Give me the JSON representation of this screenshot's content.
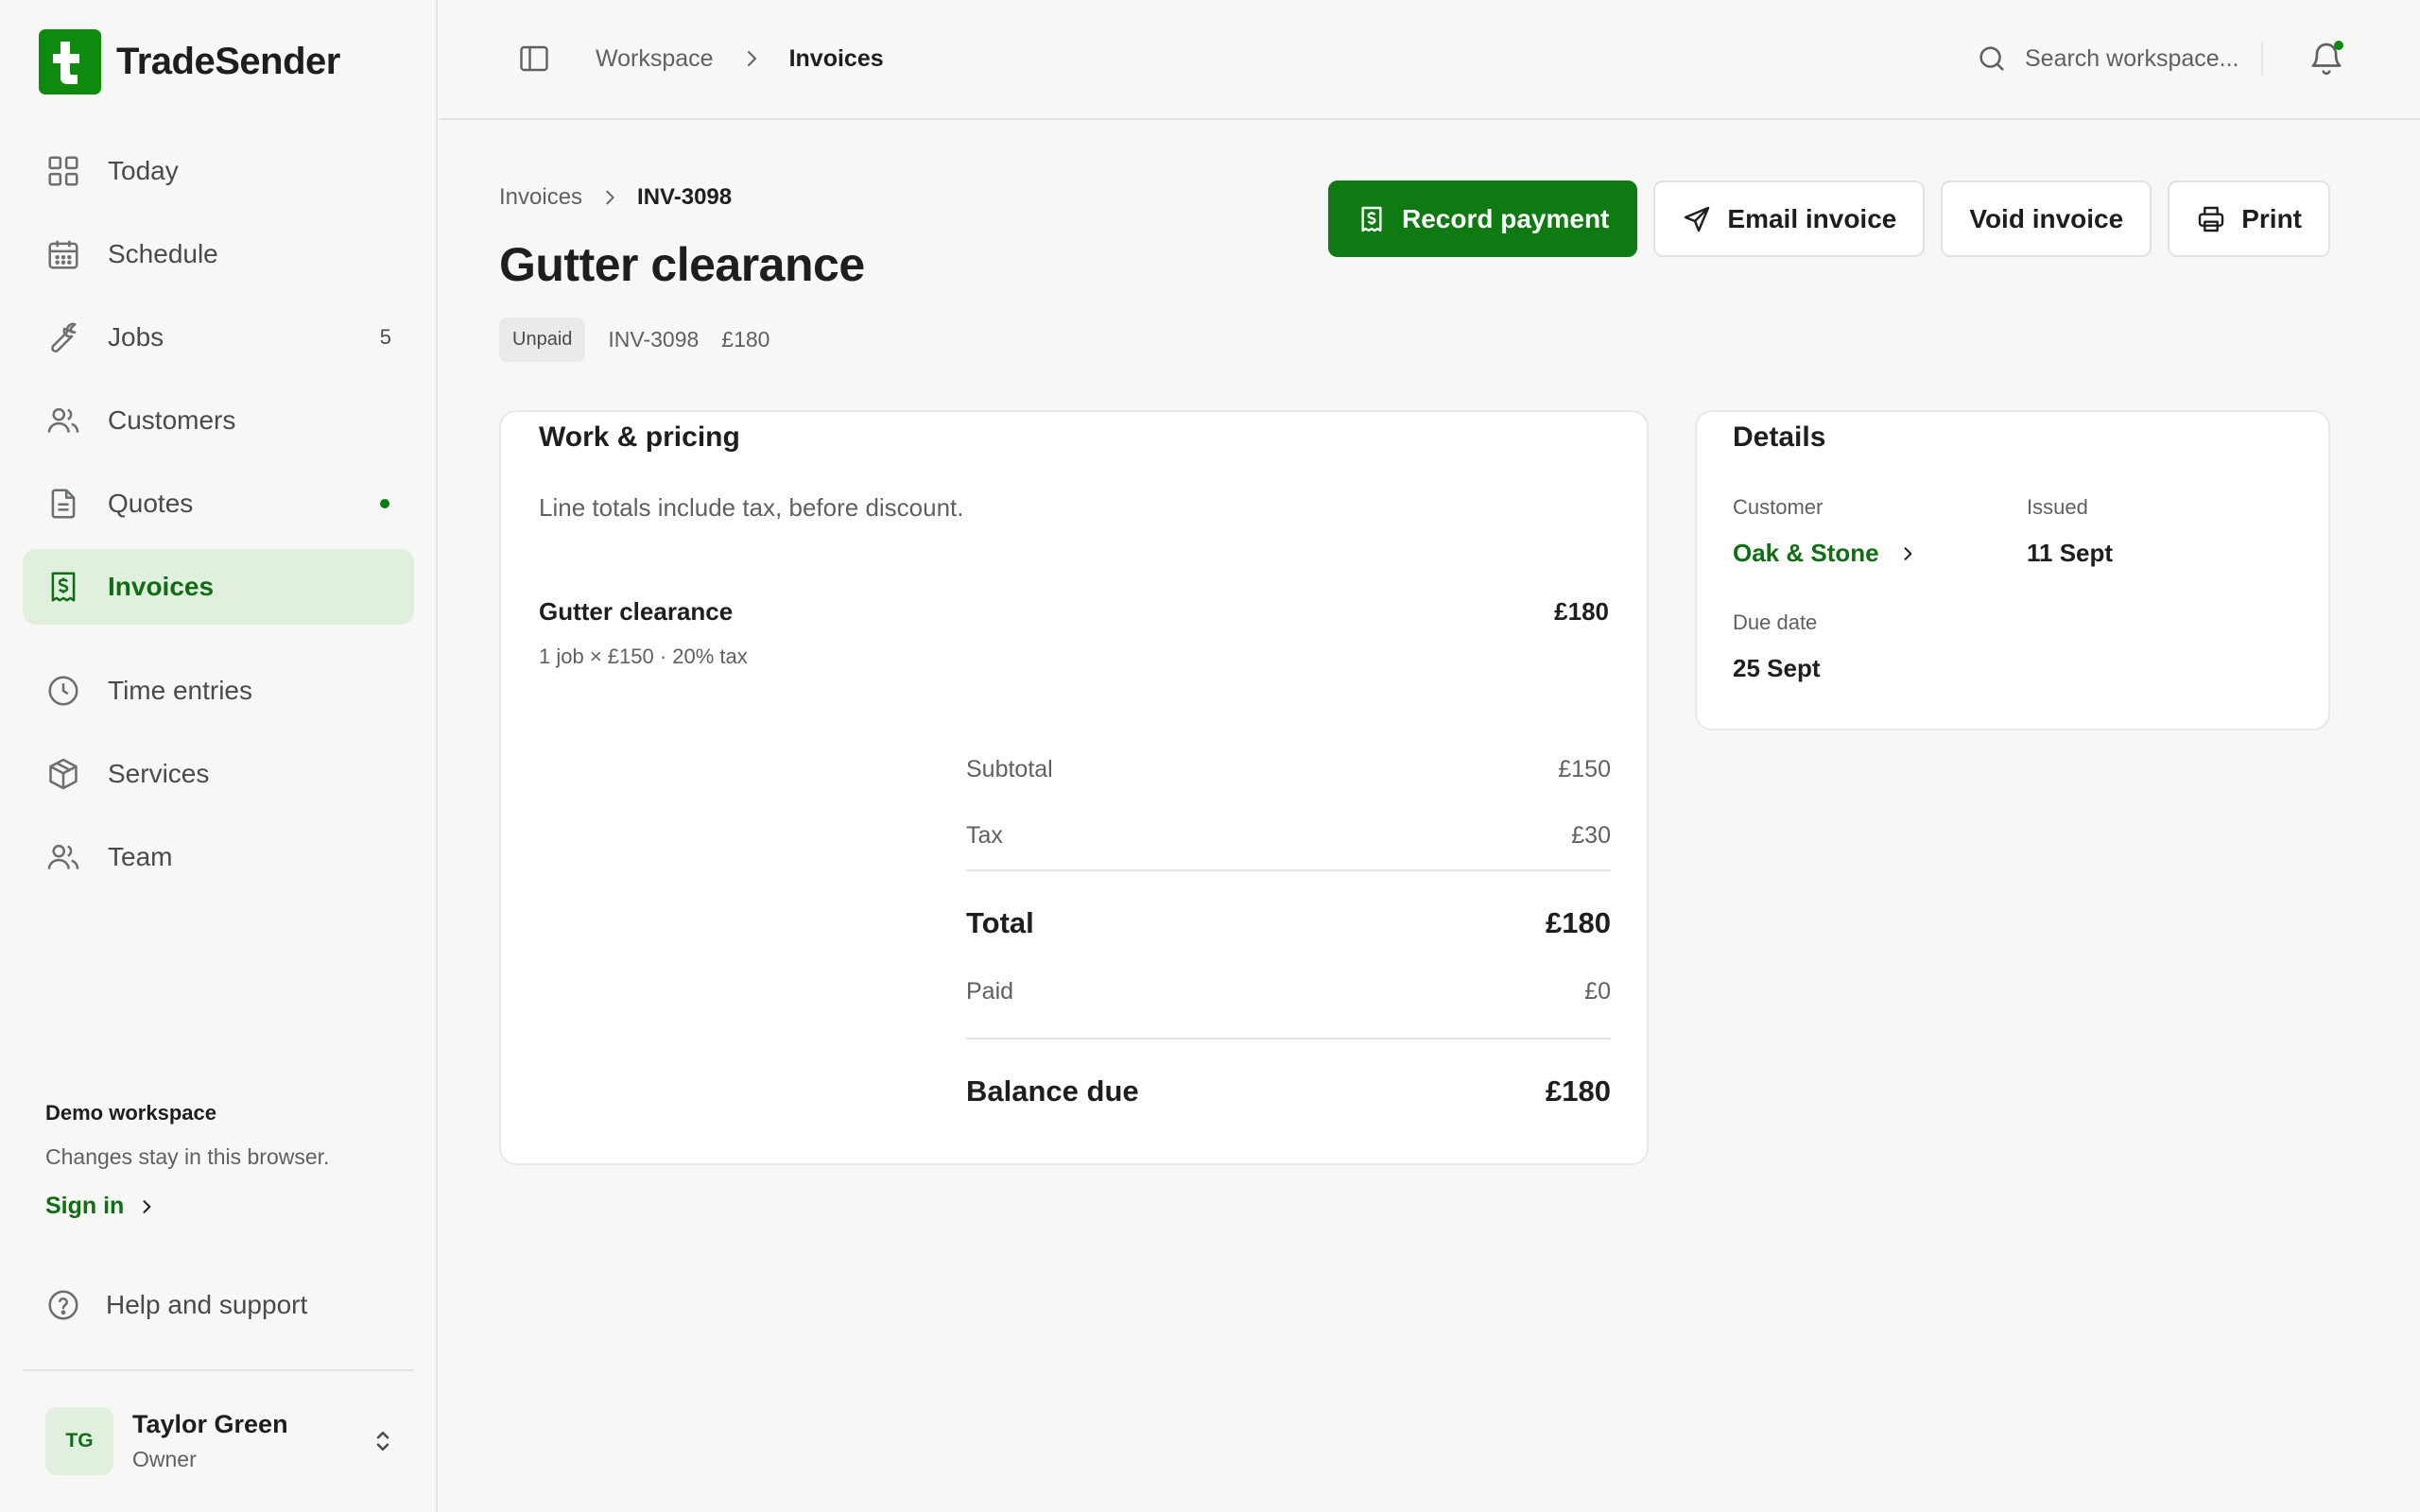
{
  "app": {
    "name": "TradeSender"
  },
  "sidebar": {
    "items": [
      {
        "label": "Today",
        "icon": "grid-icon"
      },
      {
        "label": "Schedule",
        "icon": "calendar-icon"
      },
      {
        "label": "Jobs",
        "icon": "wrench-icon",
        "count": "5"
      },
      {
        "label": "Customers",
        "icon": "users-icon"
      },
      {
        "label": "Quotes",
        "icon": "document-icon",
        "has_dot": true
      },
      {
        "label": "Invoices",
        "icon": "receipt-icon",
        "active": true
      },
      {
        "label": "Time entries",
        "icon": "clock-icon"
      },
      {
        "label": "Services",
        "icon": "package-icon"
      },
      {
        "label": "Team",
        "icon": "users-icon"
      }
    ],
    "demo": {
      "title": "Demo workspace",
      "description": "Changes stay in this browser.",
      "sign_in": "Sign in"
    },
    "help": "Help and support",
    "user": {
      "initials": "TG",
      "name": "Taylor Green",
      "role": "Owner"
    }
  },
  "topbar": {
    "breadcrumb": [
      "Workspace",
      "Invoices"
    ],
    "search_placeholder": "Search workspace...",
    "has_notification": true
  },
  "page": {
    "breadcrumb": [
      "Invoices",
      "INV-3098"
    ],
    "title": "Gutter clearance",
    "status": "Unpaid",
    "number": "INV-3098",
    "amount": "£180"
  },
  "actions": {
    "record_payment": "Record payment",
    "email_invoice": "Email invoice",
    "void_invoice": "Void invoice",
    "print": "Print"
  },
  "work": {
    "title": "Work & pricing",
    "note": "Line totals include tax, before discount.",
    "line": {
      "name": "Gutter clearance",
      "detail": "1 job × £150 · 20% tax",
      "amount": "£180"
    },
    "totals": {
      "subtotal_label": "Subtotal",
      "subtotal": "£150",
      "tax_label": "Tax",
      "tax": "£30",
      "total_label": "Total",
      "total": "£180",
      "paid_label": "Paid",
      "paid": "£0",
      "balance_label": "Balance due",
      "balance": "£180"
    }
  },
  "details": {
    "title": "Details",
    "customer_label": "Customer",
    "customer": "Oak & Stone",
    "issued_label": "Issued",
    "issued": "11 Sept",
    "due_label": "Due date",
    "due": "25 Sept"
  },
  "colors": {
    "brand": "#0e8a0e",
    "accent_dark": "#0f7a12",
    "active_bg": "#e1efdf",
    "background": "#f7f7f6"
  }
}
